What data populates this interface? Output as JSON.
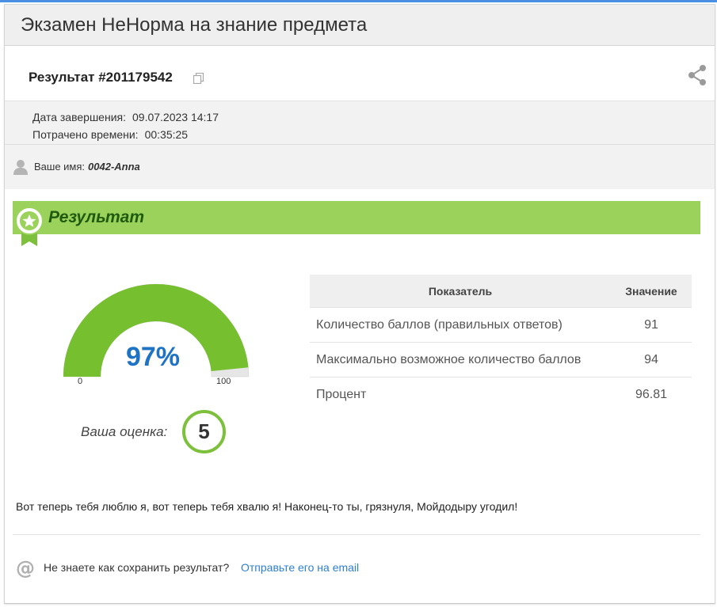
{
  "page": {
    "title": "Экзамен НеНорма на знание предмета"
  },
  "result": {
    "title": "Результат #201179542",
    "icons": {
      "copy": "copy-icon",
      "share": "share-icon"
    }
  },
  "meta": {
    "completion_label": "Дата завершения:",
    "completion_value": "09.07.2023 14:17",
    "time_label": "Потрачено времени:",
    "time_value": "00:35:25"
  },
  "user": {
    "label": "Ваше имя:",
    "name": "0042-Anna",
    "icon": "user-icon"
  },
  "banner": {
    "title": "Результат",
    "icon": "award-badge-icon",
    "color": "#9ad25b"
  },
  "gauge": {
    "value_text": "97%",
    "percent": 96.81,
    "min": "0",
    "max": "100",
    "fill_color": "#76bf2f",
    "track_color": "#e6e6e6"
  },
  "grade": {
    "label": "Ваша оценка:",
    "value": "5",
    "ring_color": "#7cc03b"
  },
  "stats_table": {
    "headers": [
      "Показатель",
      "Значение"
    ],
    "rows": [
      [
        "Количество баллов (правильных ответов)",
        "91"
      ],
      [
        "Максимально возможное количество баллов",
        "94"
      ],
      [
        "Процент",
        "96.81"
      ]
    ]
  },
  "message": "Вот теперь тебя люблю я, вот теперь тебя хвалю я! Наконец-то ты, грязнуля, Мойдодыру угодил!",
  "footer": {
    "question": "Не знаете как сохранить результат?",
    "link_text": "Отправьте его на email",
    "icon": "at-icon"
  }
}
